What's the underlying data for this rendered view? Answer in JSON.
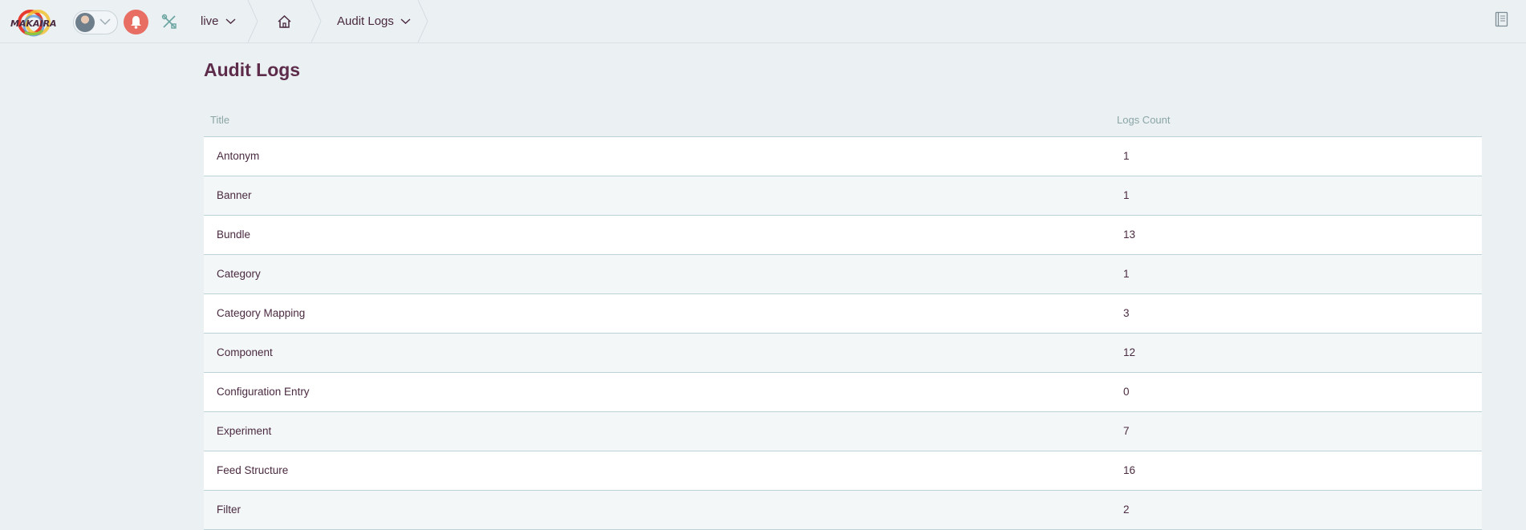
{
  "header": {
    "brand_colors": {
      "red": "#e63b2e",
      "yellow": "#f2c230",
      "blue": "#4a8fd4",
      "green": "#8dc63f"
    },
    "avatar_icon": "user-avatar",
    "notifications_icon": "bell-icon",
    "tools_icon": "tools-icon",
    "environment": "live",
    "home_icon": "home-icon",
    "current_page": "Audit Logs",
    "docs_icon": "book-icon"
  },
  "page": {
    "title": "Audit Logs"
  },
  "table": {
    "columns": {
      "title": "Title",
      "count": "Logs Count"
    },
    "rows": [
      {
        "title": "Antonym",
        "count": "1"
      },
      {
        "title": "Banner",
        "count": "1"
      },
      {
        "title": "Bundle",
        "count": "13"
      },
      {
        "title": "Category",
        "count": "1"
      },
      {
        "title": "Category Mapping",
        "count": "3"
      },
      {
        "title": "Component",
        "count": "12"
      },
      {
        "title": "Configuration Entry",
        "count": "0"
      },
      {
        "title": "Experiment",
        "count": "7"
      },
      {
        "title": "Feed Structure",
        "count": "16"
      },
      {
        "title": "Filter",
        "count": "2"
      }
    ]
  },
  "colors": {
    "accent": "#5d2c4a",
    "notification": "#e86d63",
    "background": "#ebf0f3",
    "muted": "#8aa5a6"
  }
}
